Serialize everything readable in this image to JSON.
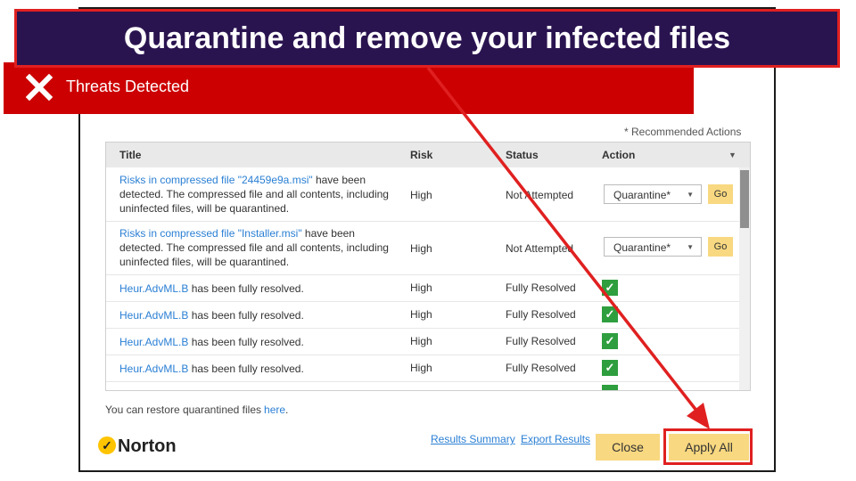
{
  "banner": {
    "text": "Quarantine and remove your infected files"
  },
  "window": {
    "title": "Threats Detected"
  },
  "recommended_note": "* Recommended Actions",
  "table": {
    "headers": [
      "Title",
      "Risk",
      "Status",
      "Action"
    ],
    "rows": [
      {
        "title_link": "Risks in compressed file \"24459e9a.msi\"",
        "title_rest": " have been detected. The compressed file and all contents, including uninfected files, will be quarantined.",
        "risk": "High",
        "status": "Not Attempted",
        "action": "Quarantine*",
        "go": "Go"
      },
      {
        "title_link": "Risks in compressed file \"Installer.msi\"",
        "title_rest": " have been detected. The compressed file and all contents, including uninfected files, will be quarantined.",
        "risk": "High",
        "status": "Not Attempted",
        "action": "Quarantine*",
        "go": "Go"
      },
      {
        "title_link": "Heur.AdvML.B",
        "title_rest": " has been fully resolved.",
        "risk": "High",
        "status": "Fully Resolved"
      },
      {
        "title_link": "Heur.AdvML.B",
        "title_rest": " has been fully resolved.",
        "risk": "High",
        "status": "Fully Resolved"
      },
      {
        "title_link": "Heur.AdvML.B",
        "title_rest": " has been fully resolved.",
        "risk": "High",
        "status": "Fully Resolved"
      },
      {
        "title_link": "Heur.AdvML.B",
        "title_rest": " has been fully resolved.",
        "risk": "High",
        "status": "Fully Resolved"
      }
    ]
  },
  "restore": {
    "text": "You can restore quarantined files",
    "link": "here",
    "tail": "."
  },
  "logo": {
    "text": "Norton"
  },
  "footer": {
    "results_summary": "Results Summary",
    "export_results": "Export Results",
    "close": "Close",
    "apply_all": "Apply All"
  },
  "colors": {
    "banner_bg": "#2a1450",
    "title_red": "#cc0000",
    "highlight": "#e02020",
    "button_yellow": "#f8d880",
    "link_blue": "#2a7fd4",
    "check_green": "#2e9e3e"
  },
  "icons": {
    "title": "close-x-icon",
    "check": "checkmark-icon",
    "logo": "norton-check-icon"
  }
}
